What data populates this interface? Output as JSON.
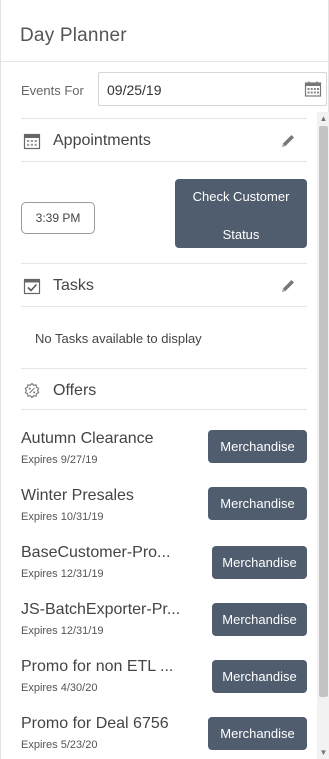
{
  "header": {
    "title": "Day Planner"
  },
  "events": {
    "label": "Events For",
    "date": "09/25/19"
  },
  "appointments": {
    "label": "Appointments",
    "time": "3:39 PM",
    "check_line1": "Check Customer",
    "check_line2": "Status"
  },
  "tasks": {
    "label": "Tasks",
    "empty": "No Tasks available to display"
  },
  "offers": {
    "label": "Offers",
    "items": [
      {
        "title": "Autumn Clearance",
        "expires": "Expires 9/27/19",
        "button": "Merchandise"
      },
      {
        "title": "Winter Presales",
        "expires": "Expires 10/31/19",
        "button": "Merchandise"
      },
      {
        "title": "BaseCustomer-Pro...",
        "expires": "Expires 12/31/19",
        "button": "Merchandise"
      },
      {
        "title": "JS-BatchExporter-Pr...",
        "expires": "Expires 12/31/19",
        "button": "Merchandise"
      },
      {
        "title": "Promo for non ETL ...",
        "expires": "Expires 4/30/20",
        "button": "Merchandise"
      },
      {
        "title": "Promo for Deal 6756",
        "expires": "Expires 5/23/20",
        "button": "Merchandise"
      }
    ]
  },
  "colors": {
    "button_bg": "#4f5d6e",
    "divider": "#e6e6e6",
    "scrollbar_thumb": "#c4c4c4"
  },
  "icons": {
    "calendar": "calendar-icon",
    "appointments": "appointment-calendar-icon",
    "edit": "pencil-icon",
    "tasks": "task-checkbox-icon",
    "offers": "offer-badge-icon"
  }
}
